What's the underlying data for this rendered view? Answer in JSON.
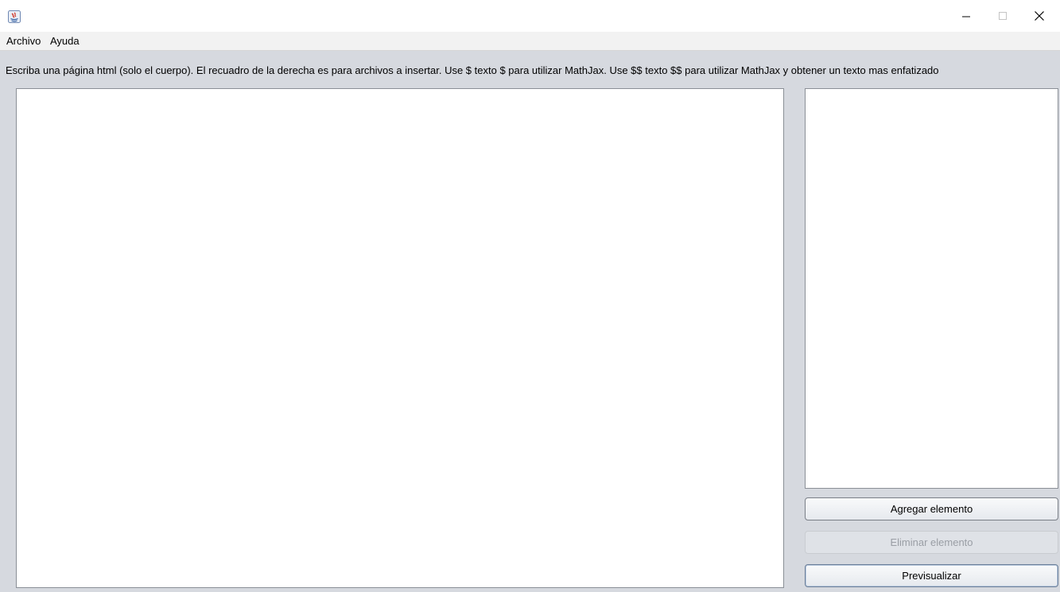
{
  "window": {
    "title": ""
  },
  "menu": {
    "items": [
      {
        "label": "Archivo"
      },
      {
        "label": "Ayuda"
      }
    ]
  },
  "main": {
    "instruction": "Escriba una página html (solo el cuerpo). El recuadro de la derecha es para archivos a insertar. Use $ texto $ para utilizar MathJax. Use $$ texto $$ para utilizar MathJax y obtener un texto mas enfatizado",
    "editor_value": "",
    "files": []
  },
  "buttons": {
    "agregar_label": "Agregar elemento",
    "eliminar_label": "Eliminar elemento",
    "eliminar_enabled": false,
    "previsualizar_label": "Previsualizar"
  },
  "icons": {
    "app": "java-app-icon",
    "minimize": "minimize-icon",
    "maximize": "maximize-icon",
    "close": "close-icon"
  },
  "colors": {
    "content_background": "#d6d9df",
    "menubar_background": "#f2f2f2",
    "disabled_text": "#9a9ea5"
  }
}
